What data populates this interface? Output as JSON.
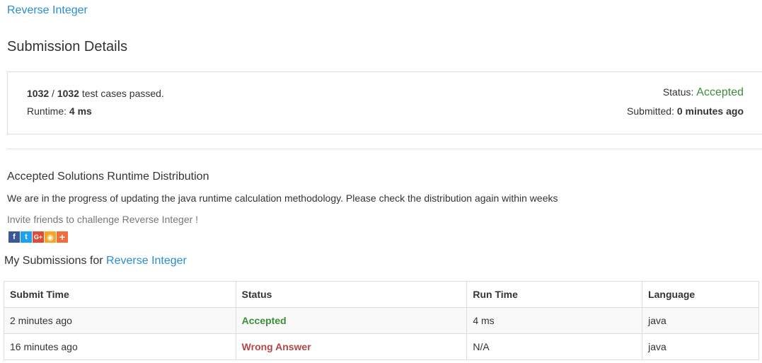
{
  "problem": {
    "title": "Reverse Integer"
  },
  "page_title": "Submission Details",
  "summary": {
    "passed": "1032",
    "separator": " / ",
    "total": "1032",
    "passed_suffix": " test cases passed.",
    "runtime_label": "Runtime: ",
    "runtime_value": "4 ms",
    "status_label": "Status: ",
    "status_value": "Accepted",
    "submitted_label": "Submitted: ",
    "submitted_value": "0 minutes ago"
  },
  "distribution": {
    "title": "Accepted Solutions Runtime Distribution",
    "note": "We are in the progress of updating the java runtime calculation methodology. Please check the distribution again within weeks"
  },
  "invite": {
    "text": "Invite friends to challenge Reverse Integer !",
    "share_buttons": [
      {
        "icon": "facebook-icon",
        "glyph": "f",
        "color": "#3b5998"
      },
      {
        "icon": "twitter-icon",
        "glyph": "t",
        "color": "#1da1f2"
      },
      {
        "icon": "google-plus-icon",
        "glyph": "G+",
        "color": "#dd4b39"
      },
      {
        "icon": "weibo-icon",
        "glyph": "◉",
        "color": "#f5a623"
      },
      {
        "icon": "add-share-icon",
        "glyph": "+",
        "color": "#f26c3c"
      }
    ]
  },
  "my_submissions": {
    "prefix": "My Submissions for ",
    "problem_link": "Reverse Integer",
    "columns": [
      "Submit Time",
      "Status",
      "Run Time",
      "Language"
    ],
    "rows": [
      {
        "submit_time": "2 minutes ago",
        "status": "Accepted",
        "run_time": "4 ms",
        "language": "java"
      },
      {
        "submit_time": "16 minutes ago",
        "status": "Wrong Answer",
        "run_time": "N/A",
        "language": "java"
      }
    ]
  },
  "colors": {
    "link": "#2a8dd4",
    "accepted": "#3c8e3c",
    "wrong": "#b34747"
  }
}
